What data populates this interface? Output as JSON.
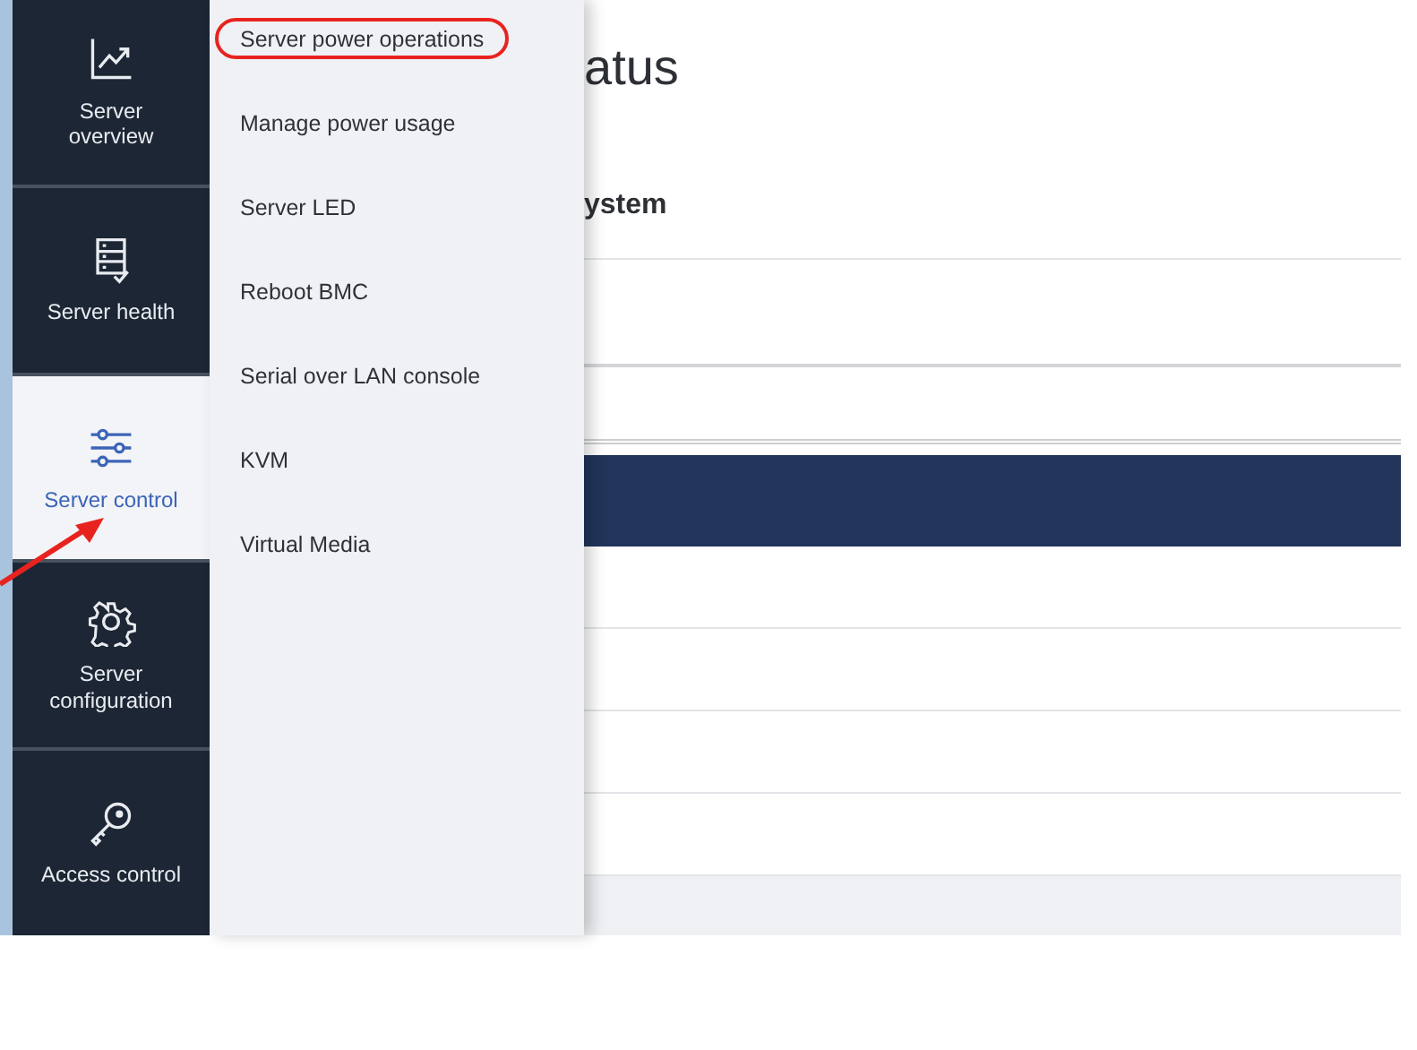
{
  "nav": [
    {
      "label": "Server overview",
      "selected": false,
      "pointed": false
    },
    {
      "label": "Server health",
      "selected": false,
      "pointed": false
    },
    {
      "label": "Server control",
      "selected": true,
      "pointed": true
    },
    {
      "label": "Server configuration",
      "selected": false,
      "pointed": false
    },
    {
      "label": "Access control",
      "selected": false,
      "pointed": false
    }
  ],
  "submenu": [
    {
      "label": "Server power operations",
      "circled": true
    },
    {
      "label": "Manage power usage",
      "circled": false
    },
    {
      "label": "Server LED",
      "circled": false
    },
    {
      "label": "Reboot BMC",
      "circled": false
    },
    {
      "label": "Serial over LAN console",
      "circled": false
    },
    {
      "label": "KVM",
      "circled": false
    },
    {
      "label": "Virtual Media",
      "circled": false
    }
  ],
  "page": {
    "title": "atus",
    "section": "ystem"
  }
}
